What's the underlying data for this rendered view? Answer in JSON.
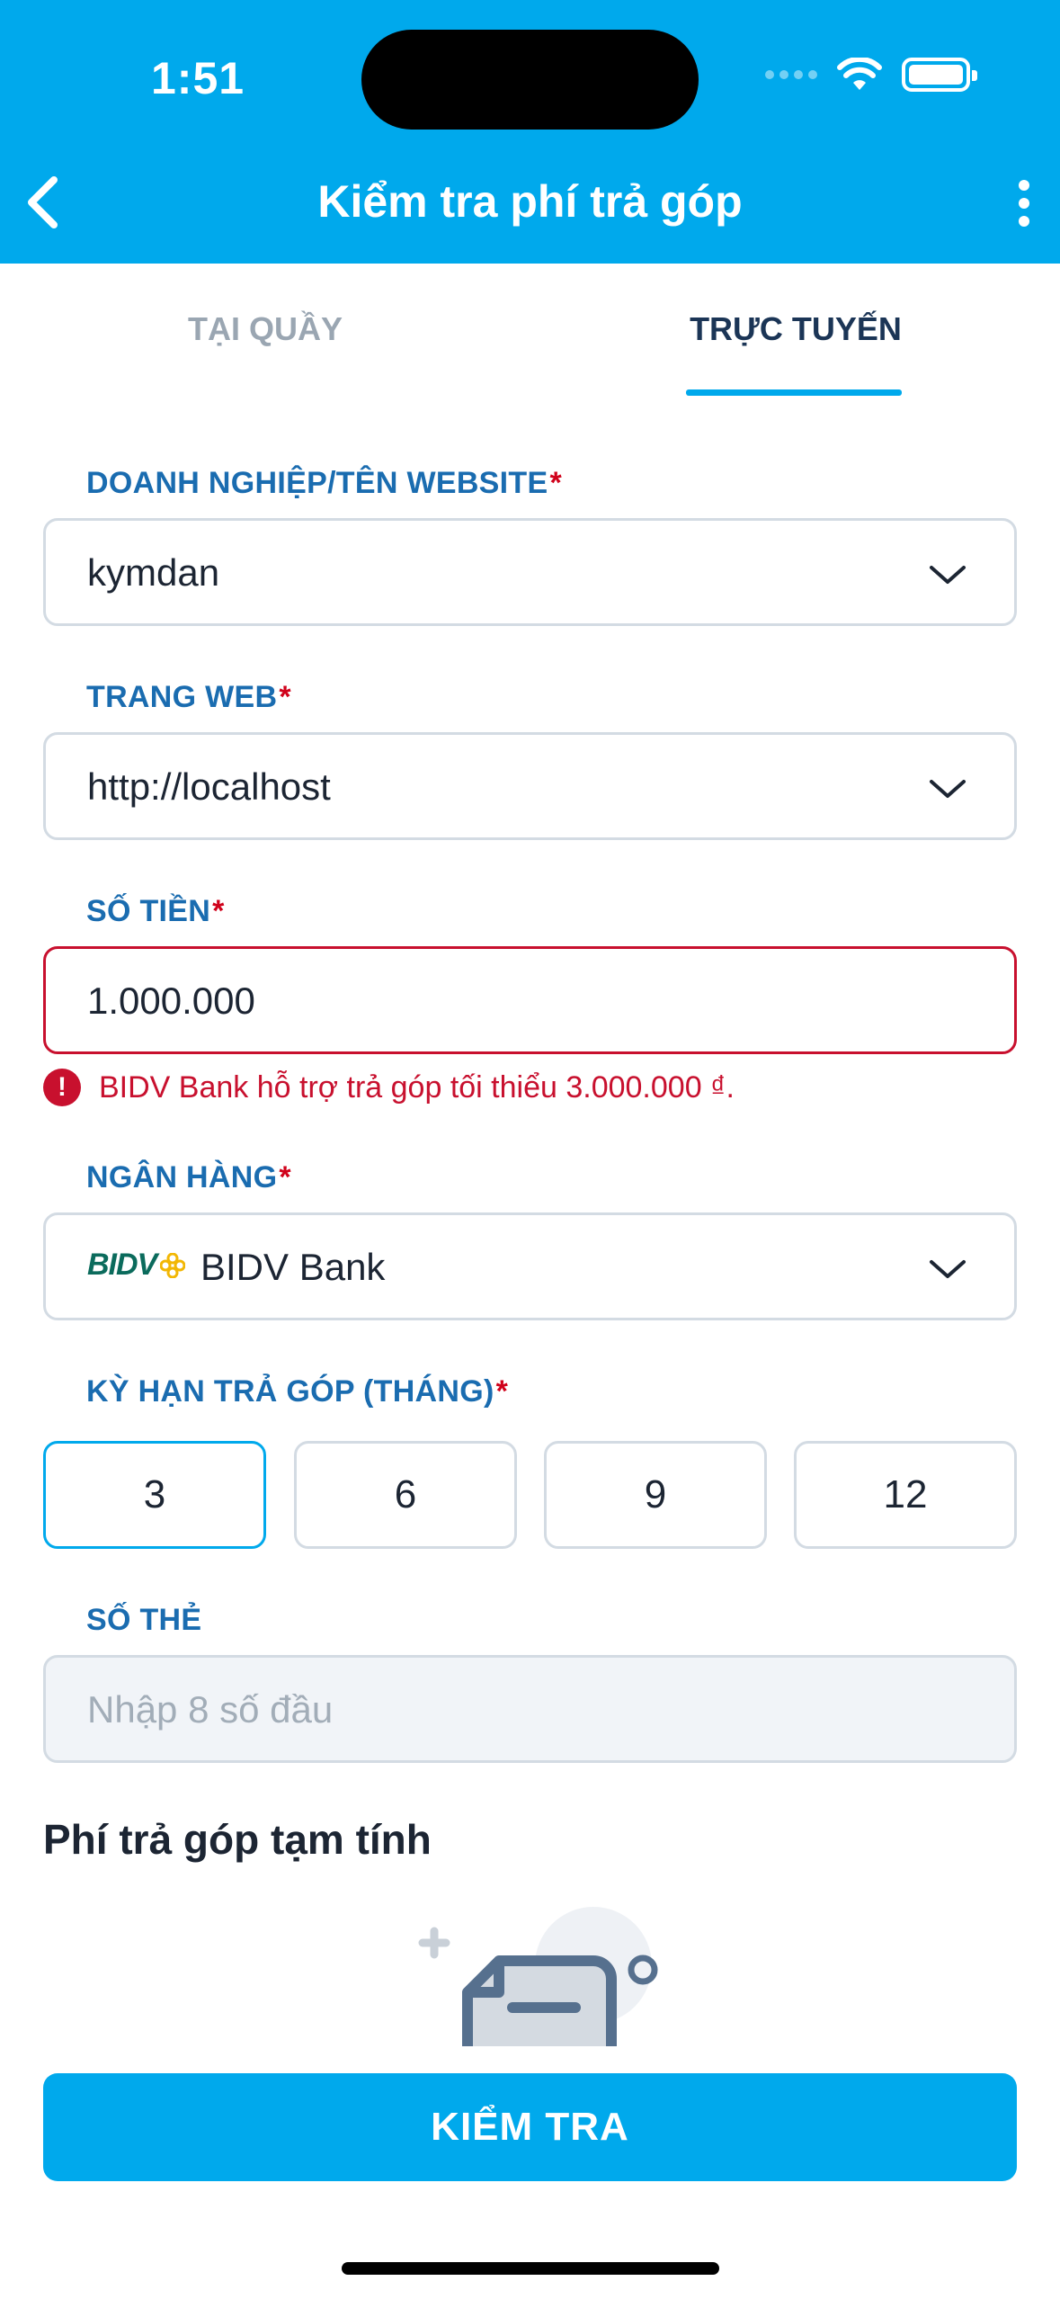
{
  "status_bar": {
    "time": "1:51"
  },
  "header": {
    "title": "Kiểm tra phí trả góp"
  },
  "tabs": [
    {
      "label": "TẠI QUẦY",
      "active": false
    },
    {
      "label": "TRỰC TUYẾN",
      "active": true
    }
  ],
  "form": {
    "merchant": {
      "label": "DOANH NGHIỆP/TÊN WEBSITE",
      "required": "*",
      "value": "kymdan"
    },
    "website": {
      "label": "TRANG WEB",
      "required": "*",
      "value": "http://localhost"
    },
    "amount": {
      "label": "SỐ TIỀN",
      "required": "*",
      "value": "1.000.000",
      "error": "BIDV Bank hỗ trợ trả góp tối thiểu 3.000.000 ₫."
    },
    "bank": {
      "label": "NGÂN HÀNG",
      "required": "*",
      "logo_text": "BIDV",
      "value": "BIDV Bank"
    },
    "term": {
      "label": "KỲ HẠN TRẢ GÓP (THÁNG)",
      "required": "*",
      "options": [
        "3",
        "6",
        "9",
        "12"
      ],
      "selected": "3"
    },
    "card": {
      "label": "SỐ THẺ",
      "placeholder": "Nhập 8 số đầu"
    }
  },
  "summary": {
    "title": "Phí trả góp tạm tính"
  },
  "actions": {
    "check_label": "KIỂM TRA"
  },
  "colors": {
    "primary": "#00a9ec",
    "label": "#1a6cb0",
    "error": "#c8102e"
  },
  "icons": [
    "back-arrow-icon",
    "more-vertical-icon",
    "chevron-down-icon",
    "error-icon",
    "wifi-icon",
    "battery-icon",
    "empty-document-illustration"
  ]
}
